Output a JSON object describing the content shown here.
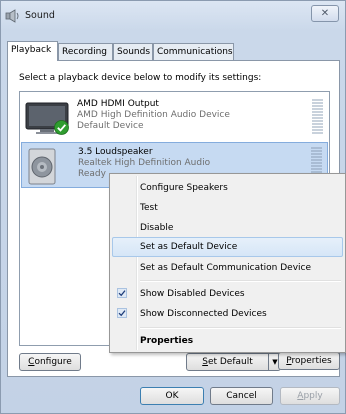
{
  "window": {
    "title": "Sound",
    "close_glyph": "✕"
  },
  "tabs": [
    {
      "label": "Playback",
      "active": true
    },
    {
      "label": "Recording",
      "active": false
    },
    {
      "label": "Sounds",
      "active": false
    },
    {
      "label": "Communications",
      "active": false
    }
  ],
  "panel": {
    "instruction": "Select a playback device below to modify its settings:"
  },
  "devices": [
    {
      "name": "AMD HDMI Output",
      "description": "AMD High Definition Audio Device",
      "status": "Default Device",
      "icon": "monitor-icon",
      "badge": "default-check-icon",
      "selected": false
    },
    {
      "name": "3.5 Loudspeaker",
      "description": "Realtek High Definition Audio",
      "status": "Ready",
      "icon": "speaker-icon",
      "selected": true
    }
  ],
  "buttons": {
    "configure": {
      "label_underlined": "C",
      "label_rest": "onfigure"
    },
    "set_default": {
      "label_underlined": "S",
      "label_rest": "et Default",
      "arrow": "▼"
    },
    "properties": {
      "label_underlined": "P",
      "label_rest": "roperties"
    },
    "ok": "OK",
    "cancel": "Cancel",
    "apply": {
      "label_underlined": "A",
      "label_rest": "pply",
      "enabled": false
    }
  },
  "context_menu": {
    "items": [
      {
        "label": "Configure Speakers"
      },
      {
        "label": "Test"
      },
      {
        "label": "Disable"
      },
      {
        "label": "Set as Default Device",
        "highlighted": true
      },
      {
        "label": "Set as Default Communication Device"
      },
      {
        "label": "Show Disabled Devices",
        "checked": true
      },
      {
        "label": "Show Disconnected Devices",
        "checked": true
      },
      {
        "label": "Properties",
        "bold": true
      }
    ]
  },
  "colors": {
    "selection": "#c6daf2",
    "menu_highlight": "#d6e6f7",
    "check_green": "#2f9d2f"
  }
}
